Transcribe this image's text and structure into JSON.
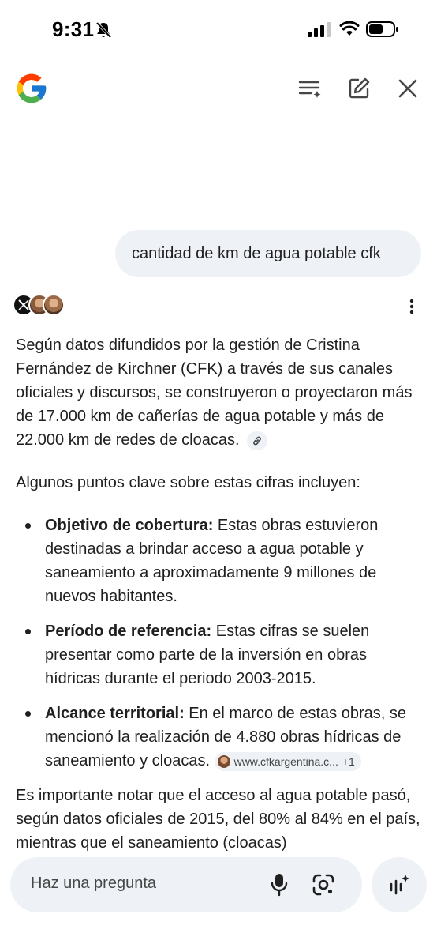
{
  "status_bar": {
    "time": "9:31",
    "icons": [
      "bell-slash-icon",
      "signal-icon",
      "wifi-icon",
      "battery-icon"
    ]
  },
  "header": {
    "logo": "google-g-logo",
    "buttons": [
      "history-icon",
      "edit-icon",
      "close-icon"
    ]
  },
  "query": {
    "text": "cantidad de km de agua potable cfk"
  },
  "answer": {
    "sources_icons": [
      "x-logo",
      "avatar",
      "avatar"
    ],
    "intro": "Según datos difundidos por la gestión de Cristina Fernández de Kirchner (CFK) a través de sus canales oficiales y discursos, se construyeron o proyectaron más de 17.000 km de cañerías de agua potable y más de 22.000 km de redes de cloacas.",
    "lead": "Algunos puntos clave sobre estas cifras incluyen:",
    "bullets": [
      {
        "title": "Objetivo de cobertura:",
        "text": " Estas obras estuvieron destinadas a brindar acceso a agua potable y saneamiento a aproximadamente 9 millones de nuevos habitantes."
      },
      {
        "title": "Período de referencia:",
        "text": " Estas cifras se suelen presentar como parte de la inversión en obras hídricas durante el periodo 2003-2015."
      },
      {
        "title": "Alcance territorial:",
        "text": " En el marco de estas obras, se mencionó la realización de 4.880 obras hídricas de saneamiento y cloacas."
      }
    ],
    "source_chip": {
      "label": "www.cfkargentina.c...",
      "extra": "+1"
    },
    "closing": "Es importante notar que el acceso al agua potable pasó, según datos oficiales de 2015, del 80% al 84% en el país, mientras que el saneamiento (cloacas)"
  },
  "input": {
    "placeholder": "Haz una pregunta"
  },
  "colors": {
    "bubble_bg": "#eef1f6",
    "text": "#1f1f1f",
    "secondary_text": "#444746"
  }
}
